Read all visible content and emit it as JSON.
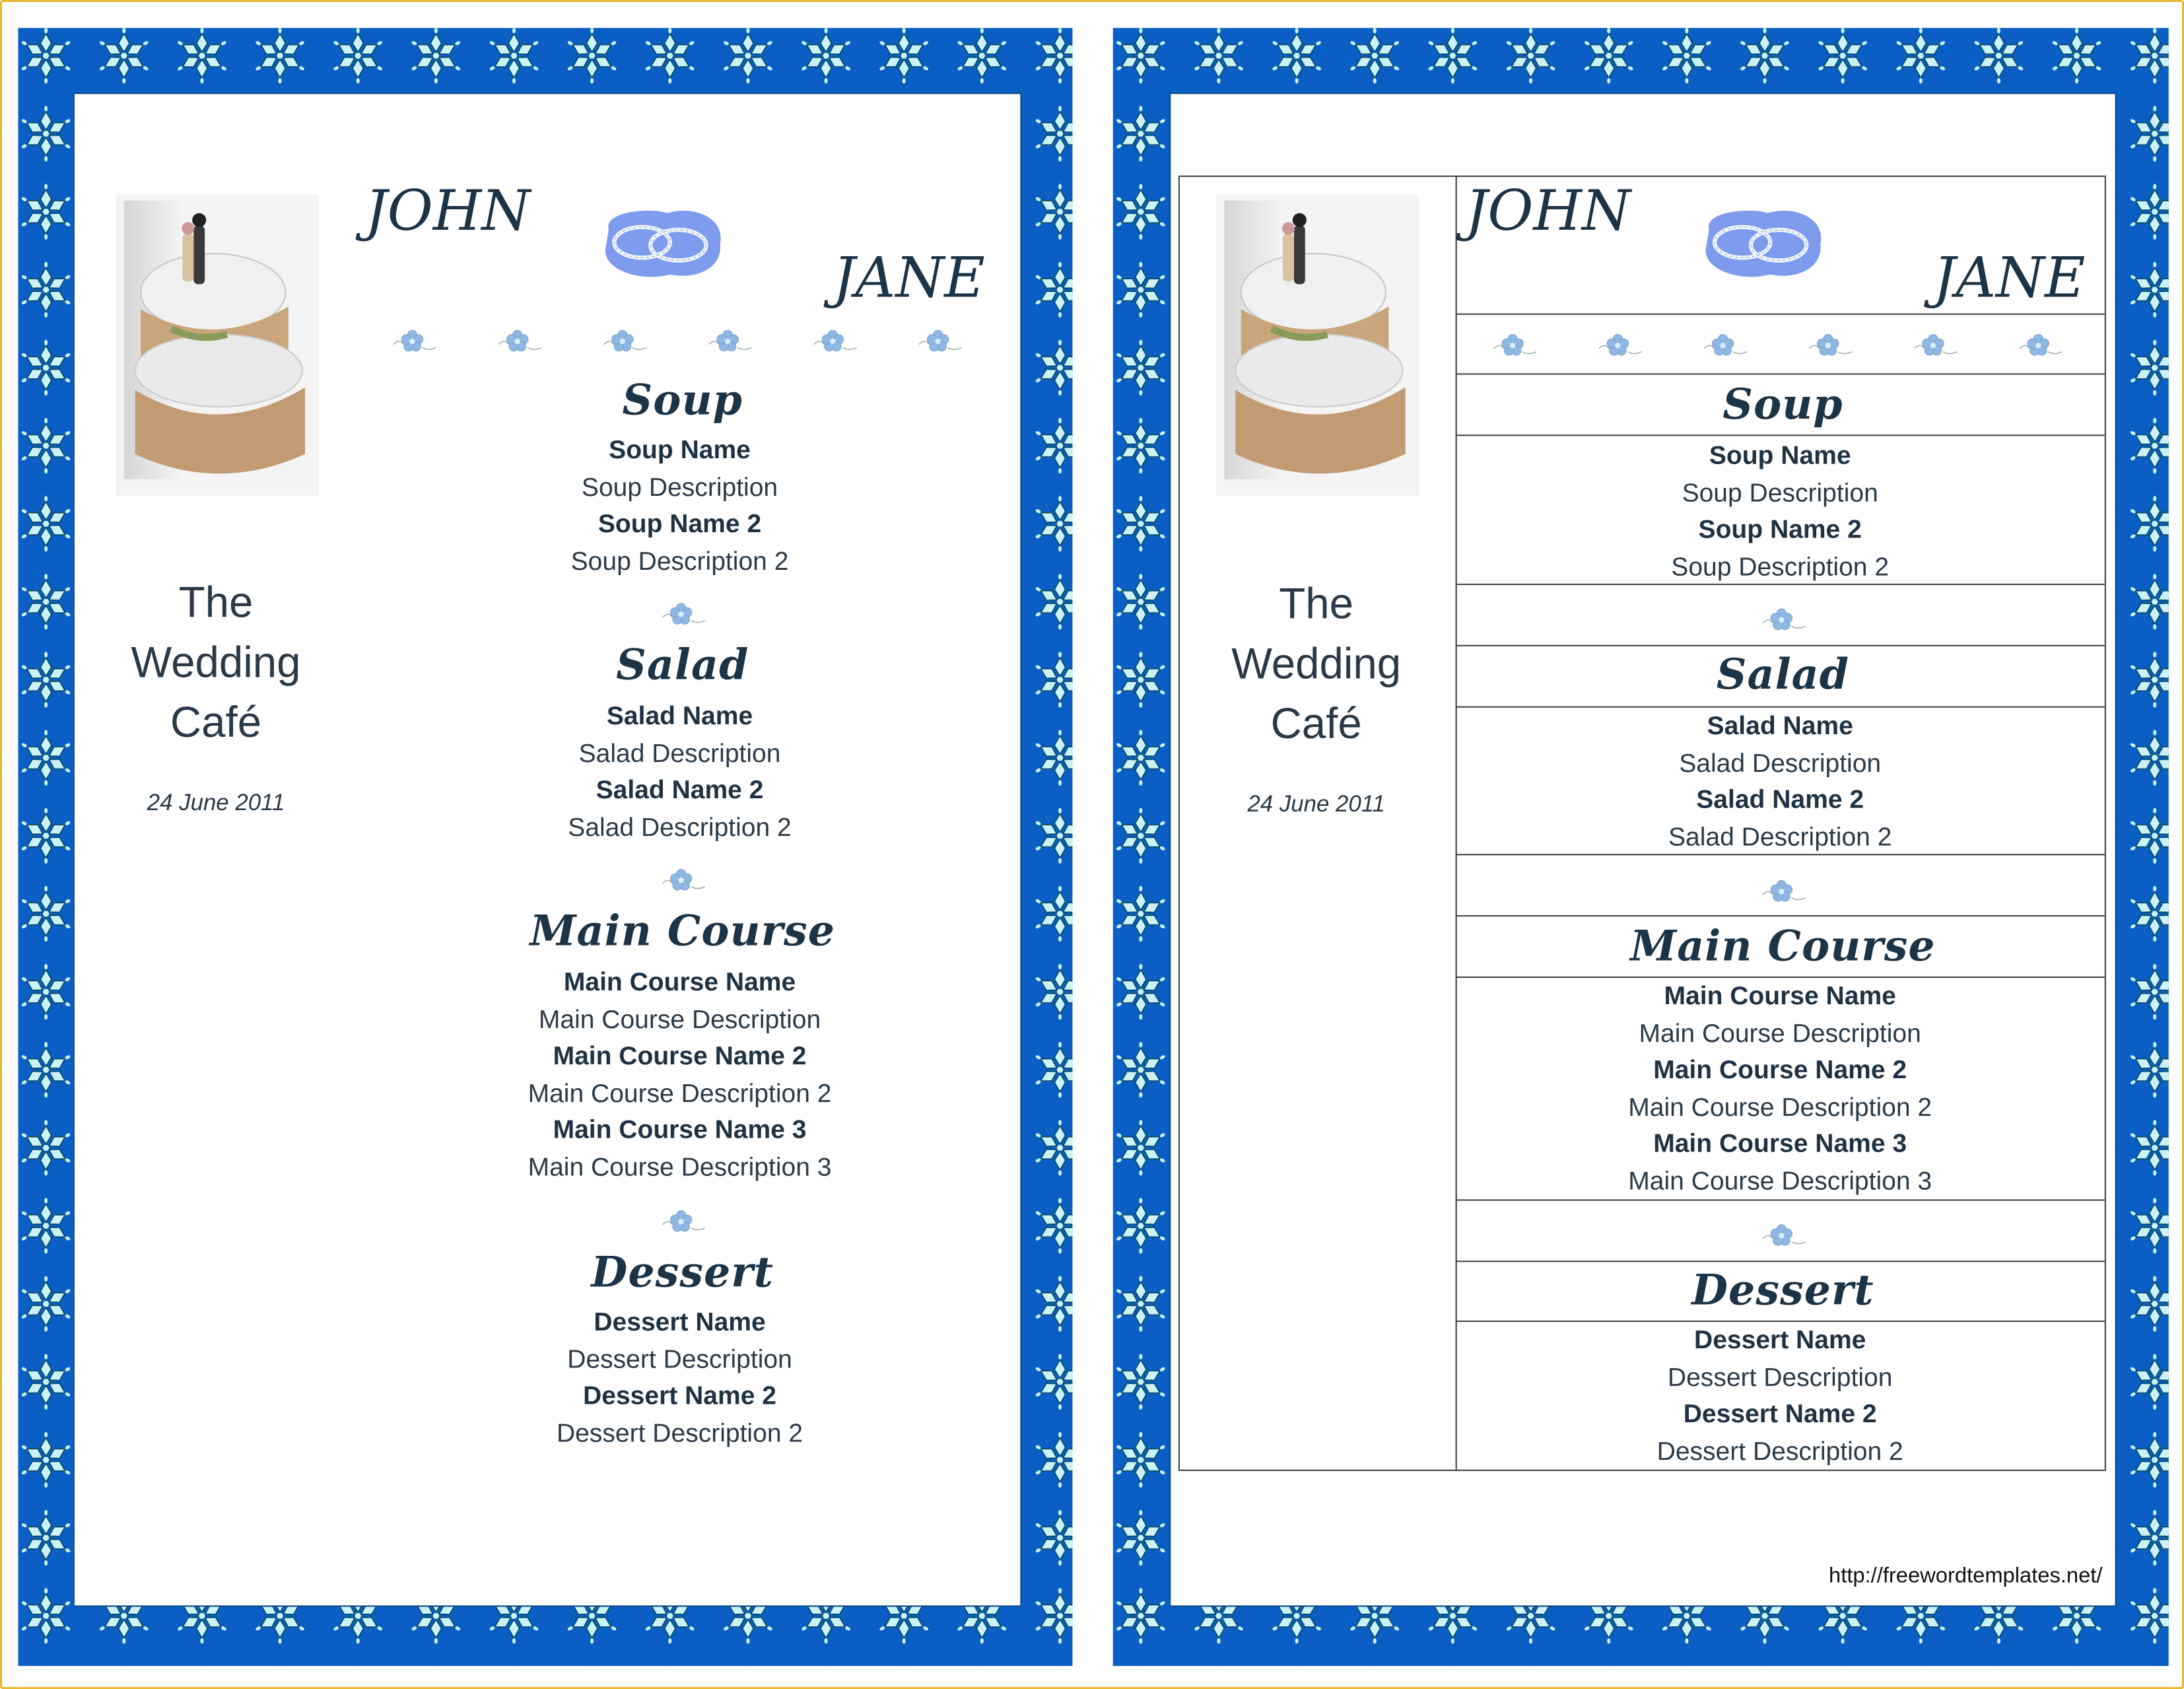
{
  "couple": {
    "groom": "JOHN",
    "bride": "JANE"
  },
  "venue": {
    "line1": "The",
    "line2": "Wedding",
    "line3": "Café",
    "date": "24 June 2011"
  },
  "menu": {
    "sections": [
      {
        "title": "Soup",
        "items": [
          "Soup Name",
          "Soup Description",
          "Soup Name 2",
          "Soup Description 2"
        ]
      },
      {
        "title": "Salad",
        "items": [
          "Salad Name",
          "Salad Description",
          "Salad Name 2",
          "Salad Description 2"
        ]
      },
      {
        "title": "Main Course",
        "items": [
          "Main Course Name",
          "Main Course Description",
          "Main Course Name 2",
          "Main Course Description 2",
          "Main Course Name 3",
          "Main Course Description 3"
        ]
      },
      {
        "title": "Dessert",
        "items": [
          "Dessert Name",
          "Dessert Description",
          "Dessert Name 2",
          "Dessert Description 2"
        ]
      }
    ]
  },
  "footer": {
    "url": "http://freewordtemplates.net/"
  },
  "colors": {
    "border_blue": "#0b5fc4",
    "star": "#c9f3f8",
    "frame_gold": "#e6b82e",
    "text": "#1f3244",
    "rings_blob": "#7f9bee"
  },
  "icons": [
    "snowflake-star-border",
    "wedding-cake-image",
    "wedding-rings-icon",
    "forget-me-not-flower-icon"
  ]
}
